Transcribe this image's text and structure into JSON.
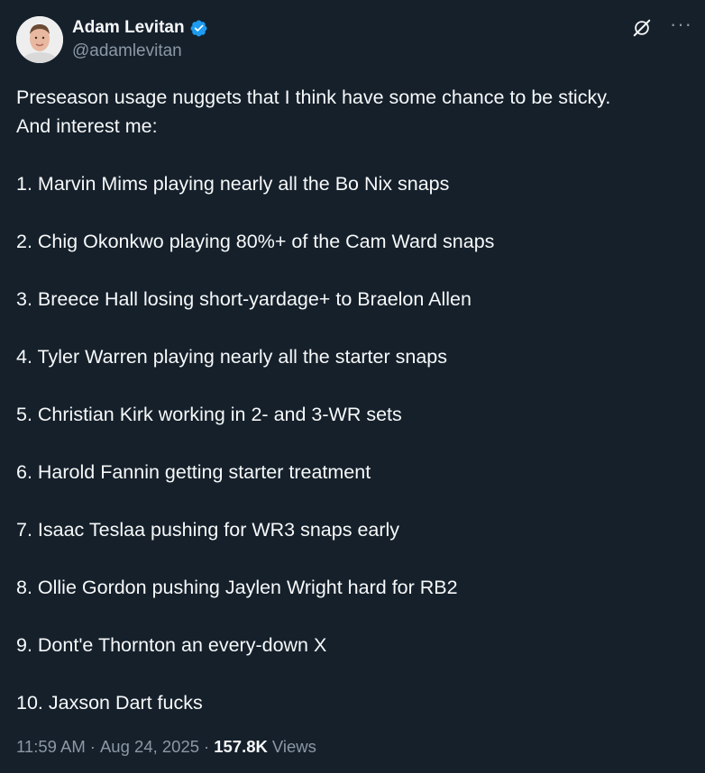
{
  "author": {
    "display_name": "Adam Levitan",
    "handle": "@adamlevitan"
  },
  "tweet": {
    "intro_line1": "Preseason usage nuggets that I think have some chance to be sticky.",
    "intro_line2": "And interest me:",
    "items": [
      "1. Marvin Mims playing nearly all the Bo Nix snaps",
      "2. Chig Okonkwo playing 80%+ of the Cam Ward snaps",
      "3. Breece Hall losing short-yardage+ to Braelon Allen",
      "4. Tyler Warren playing nearly all the starter snaps",
      "5. Christian Kirk working in 2- and 3-WR sets",
      "6. Harold Fannin getting starter treatment",
      "7. Isaac Teslaa pushing for WR3 snaps early",
      "8. Ollie Gordon pushing Jaylen Wright hard for RB2",
      "9. Dont'e Thornton an every-down X",
      "10. Jaxson Dart fucks"
    ]
  },
  "meta": {
    "time": "11:59 AM",
    "date": "Aug 24, 2025",
    "separator": "·",
    "views_count": "157.8K",
    "views_label": "Views"
  },
  "icons": {
    "verified": "verified-badge-icon",
    "grok": "grok-icon",
    "more": "more-icon"
  },
  "colors": {
    "background": "#15202b",
    "text": "#f7f9f9",
    "secondary": "#8b98a5",
    "verified": "#1d9bf0"
  }
}
